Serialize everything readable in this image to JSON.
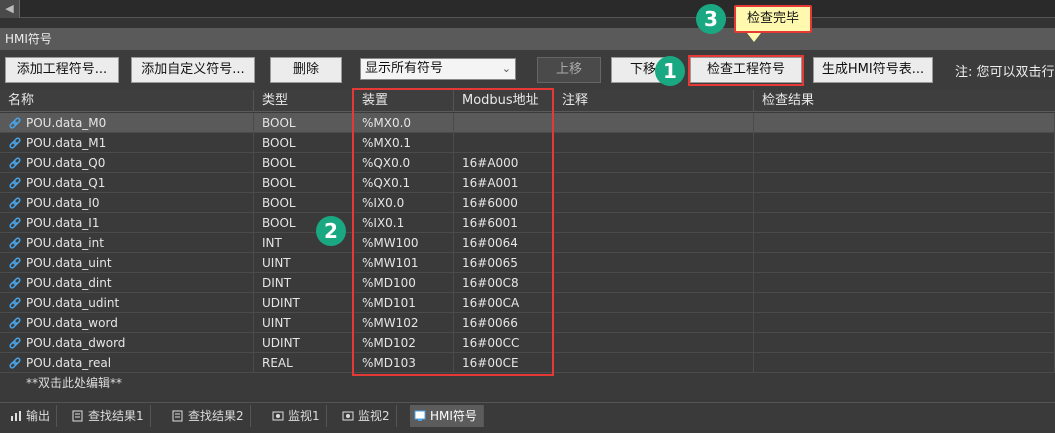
{
  "panel_title": "HMI符号",
  "toolbar": {
    "add_project_symbol": "添加工程符号...",
    "add_custom_symbol": "添加自定义符号...",
    "delete": "删除",
    "filter_value": "显示所有符号",
    "move_up": "上移",
    "move_down": "下移",
    "check_symbols": "检查工程符号",
    "generate_table": "生成HMI符号表...",
    "note": "注: 您可以双击行"
  },
  "tooltip": "检查完毕",
  "badges": [
    "1",
    "2",
    "3"
  ],
  "columns": [
    "名称",
    "类型",
    "装置",
    "Modbus地址",
    "注释",
    "检查结果"
  ],
  "rows": [
    {
      "name": "POU.data_M0",
      "type": "BOOL",
      "device": "%MX0.0",
      "modbus": "",
      "comment": "",
      "result": ""
    },
    {
      "name": "POU.data_M1",
      "type": "BOOL",
      "device": "%MX0.1",
      "modbus": "",
      "comment": "",
      "result": ""
    },
    {
      "name": "POU.data_Q0",
      "type": "BOOL",
      "device": "%QX0.0",
      "modbus": "16#A000",
      "comment": "",
      "result": ""
    },
    {
      "name": "POU.data_Q1",
      "type": "BOOL",
      "device": "%QX0.1",
      "modbus": "16#A001",
      "comment": "",
      "result": ""
    },
    {
      "name": "POU.data_I0",
      "type": "BOOL",
      "device": "%IX0.0",
      "modbus": "16#6000",
      "comment": "",
      "result": ""
    },
    {
      "name": "POU.data_I1",
      "type": "BOOL",
      "device": "%IX0.1",
      "modbus": "16#6001",
      "comment": "",
      "result": ""
    },
    {
      "name": "POU.data_int",
      "type": "INT",
      "device": "%MW100",
      "modbus": "16#0064",
      "comment": "",
      "result": ""
    },
    {
      "name": "POU.data_uint",
      "type": "UINT",
      "device": "%MW101",
      "modbus": "16#0065",
      "comment": "",
      "result": ""
    },
    {
      "name": "POU.data_dint",
      "type": "DINT",
      "device": "%MD100",
      "modbus": "16#00C8",
      "comment": "",
      "result": ""
    },
    {
      "name": "POU.data_udint",
      "type": "UDINT",
      "device": "%MD101",
      "modbus": "16#00CA",
      "comment": "",
      "result": ""
    },
    {
      "name": "POU.data_word",
      "type": "UINT",
      "device": "%MW102",
      "modbus": "16#0066",
      "comment": "",
      "result": ""
    },
    {
      "name": "POU.data_dword",
      "type": "UDINT",
      "device": "%MD102",
      "modbus": "16#00CC",
      "comment": "",
      "result": ""
    },
    {
      "name": "POU.data_real",
      "type": "REAL",
      "device": "%MD103",
      "modbus": "16#00CE",
      "comment": "",
      "result": ""
    }
  ],
  "edit_hint": "**双击此处编辑**",
  "tabs": [
    "输出",
    "查找结果1",
    "查找结果2",
    "监视1",
    "监视2",
    "HMI符号"
  ]
}
